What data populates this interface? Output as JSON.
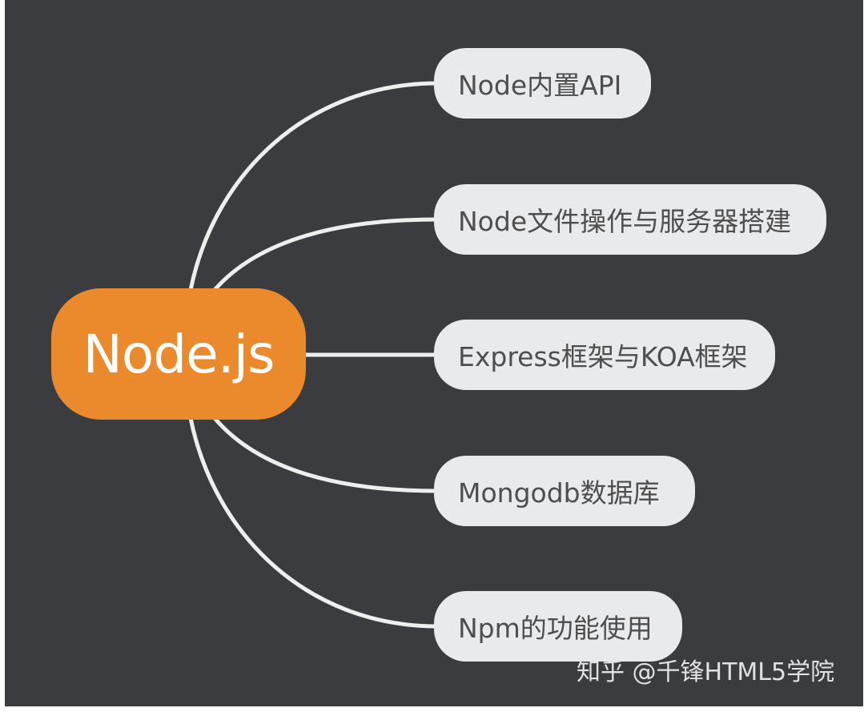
{
  "diagram": {
    "root": {
      "label": "Node.js",
      "color": "#ea8a2c"
    },
    "branches": [
      {
        "label": "Node内置API"
      },
      {
        "label": "Node文件操作与服务器搭建"
      },
      {
        "label": "Express框架与KOA框架"
      },
      {
        "label": "Mongodb数据库"
      },
      {
        "label": "Npm的功能使用"
      }
    ],
    "colors": {
      "background": "#3b3c40",
      "branch_fill": "#e9eaec",
      "connector": "#eeeeee"
    }
  },
  "watermark": {
    "text": "知乎 @千锋HTML5学院"
  }
}
